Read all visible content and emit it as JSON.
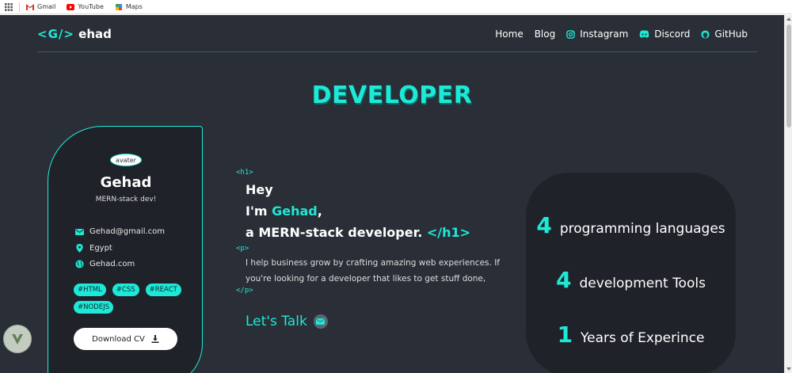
{
  "browser": {
    "bookmarks": [
      {
        "label": "Gmail",
        "icon": "gmail-icon"
      },
      {
        "label": "YouTube",
        "icon": "youtube-icon"
      },
      {
        "label": "Maps",
        "icon": "maps-icon"
      }
    ]
  },
  "nav": {
    "logo_code": "<G/>",
    "logo_name": "ehad",
    "links": [
      {
        "label": "Home"
      },
      {
        "label": "Blog"
      },
      {
        "label": "Instagram",
        "icon": "instagram-icon"
      },
      {
        "label": "Discord",
        "icon": "discord-icon"
      },
      {
        "label": "GitHub",
        "icon": "github-icon"
      }
    ]
  },
  "hero": {
    "title": "DEVELOPER"
  },
  "profile": {
    "avatar_alt": "avater",
    "name": "Gehad",
    "role": "MERN-stack dev!",
    "email": "Gehad@gmail.com",
    "location": "Egypt",
    "website": "Gehad.com",
    "tags": [
      "#HTML",
      "#CSS",
      "#REACT",
      "#NODEJS"
    ],
    "cv_button": "Download CV"
  },
  "intro": {
    "h1_open": "<h1>",
    "line1": "Hey",
    "line2_prefix": "I'm ",
    "line2_name": "Gehad",
    "line2_suffix": ",",
    "line3": "a MERN-stack developer.",
    "h1_close": "</h1>",
    "p_open": "<p>",
    "paragraph": "I help business grow by crafting amazing web experiences. If you're looking for a developer that likes to get stuff done,",
    "p_close": "</p>",
    "cta": "Let's Talk"
  },
  "stats": [
    {
      "number": "4",
      "label": "programming languages"
    },
    {
      "number": "4",
      "label": "development Tools"
    },
    {
      "number": "1",
      "label": "Years of Experince"
    }
  ],
  "colors": {
    "accent": "#1de9d8",
    "background": "#2a2f37",
    "card": "#1f2329"
  }
}
